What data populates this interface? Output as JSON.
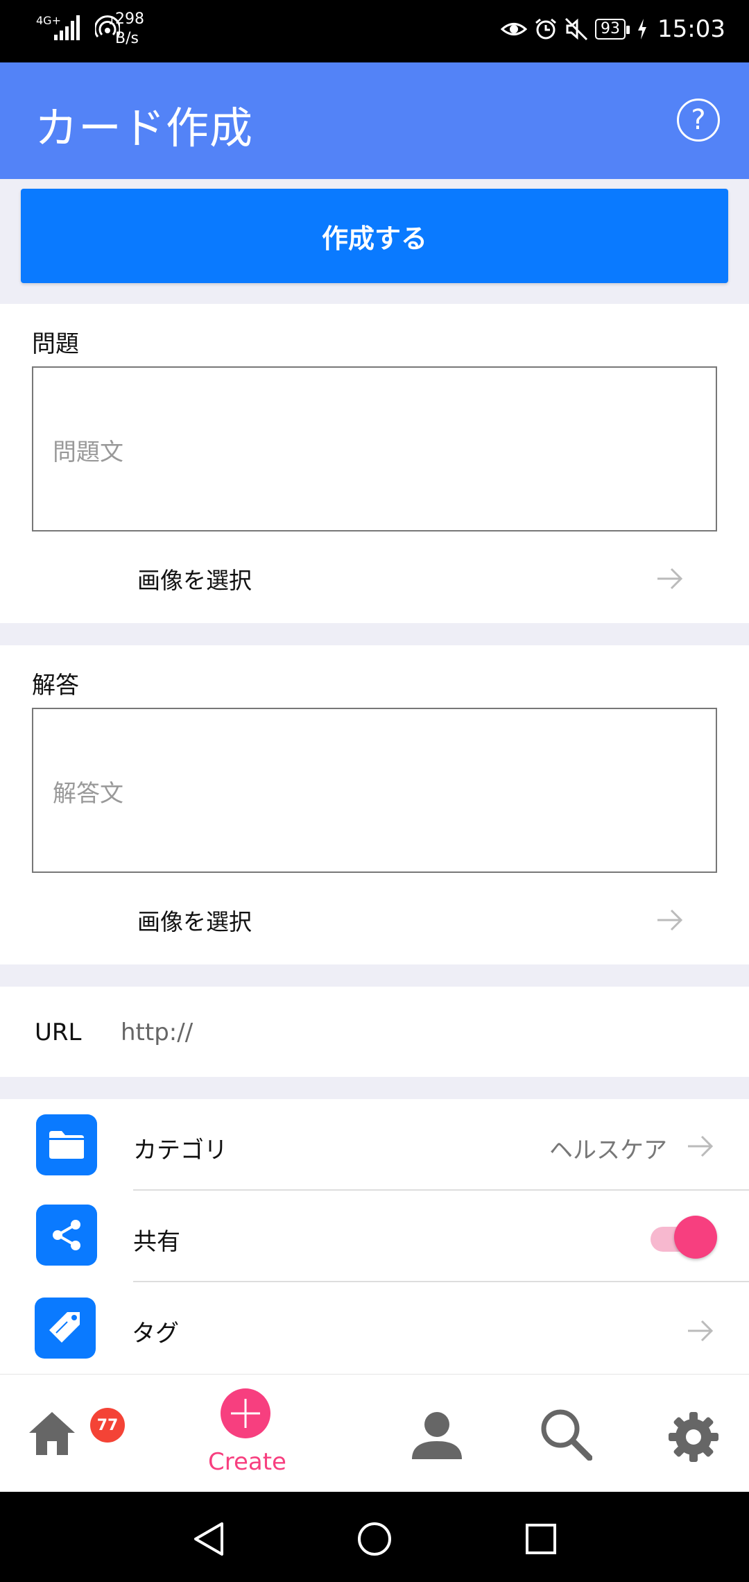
{
  "status_bar": {
    "network": "4G+",
    "data_count": "1",
    "speed_value": "298",
    "speed_unit": "B/s",
    "battery": "93",
    "time": "15:03"
  },
  "app_bar": {
    "title": "カード作成",
    "help_label": "?"
  },
  "create_button": "作成する",
  "question": {
    "title": "問題",
    "placeholder": "問題文",
    "image_select": "画像を選択"
  },
  "answer": {
    "title": "解答",
    "placeholder": "解答文",
    "image_select": "画像を選択"
  },
  "url": {
    "label": "URL",
    "value": "http://"
  },
  "settings": {
    "category": {
      "label": "カテゴリ",
      "value": "ヘルスケア",
      "icon": "folder-icon"
    },
    "share": {
      "label": "共有",
      "enabled": true,
      "icon": "share-icon"
    },
    "tag": {
      "label": "タグ",
      "icon": "tag-icon"
    }
  },
  "bottom_nav": {
    "home_badge": "77",
    "create_label": "Create",
    "active_color": "#f73f7f"
  },
  "colors": {
    "app_bar": "#5383f7",
    "primary_button": "#0a7aff",
    "icon_tile": "#0a7aff",
    "accent": "#f73f7f"
  }
}
